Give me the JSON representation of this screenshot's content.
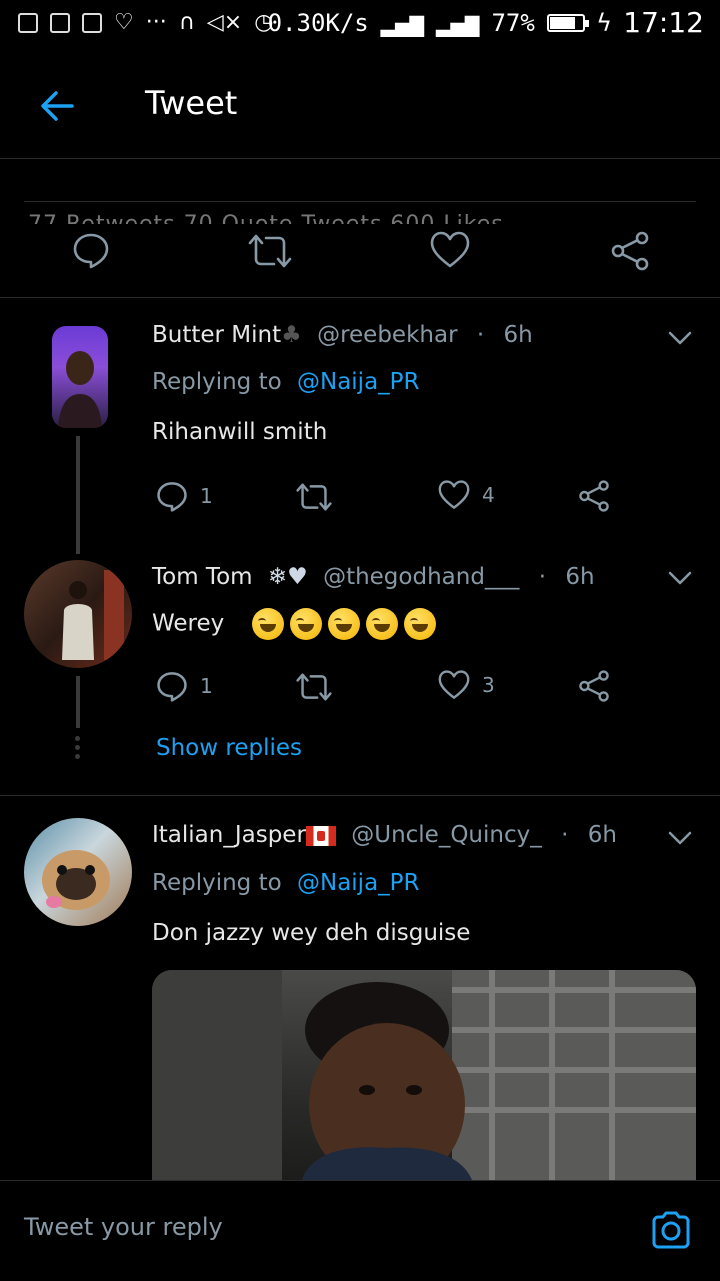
{
  "status_bar": {
    "speed": "0.30K/s",
    "battery": "77%",
    "battery_level": 0.77,
    "time": "17:12"
  },
  "header": {
    "title": "Tweet",
    "stats_ghost": "77 Retweets   70 Quote Tweets   600 Likes"
  },
  "tweets": [
    {
      "name": "Butter Mint",
      "name_emoji": "♣",
      "handle": "@reebekhar",
      "time": "6h",
      "replying_to_label": "Replying to",
      "replying_to": "@Naija_PR",
      "text": "Rihanwill smith",
      "replies": "1",
      "likes": "4"
    },
    {
      "name": "Tom Tom",
      "name_emoji": "❄♥",
      "handle": "@thegodhand___",
      "time": "6h",
      "text": "Werey",
      "replies": "1",
      "likes": "3",
      "show_replies": "Show replies"
    },
    {
      "name": "Italian_Jasper",
      "handle": "@Uncle_Quincy_",
      "time": "6h",
      "replying_to_label": "Replying to",
      "replying_to": "@Naija_PR",
      "text": "Don jazzy wey deh disguise"
    }
  ],
  "reply_bar": {
    "placeholder": "Tweet your reply"
  },
  "colors": {
    "accent": "#1da1f2",
    "muted": "#8899a6",
    "background": "#000000"
  }
}
